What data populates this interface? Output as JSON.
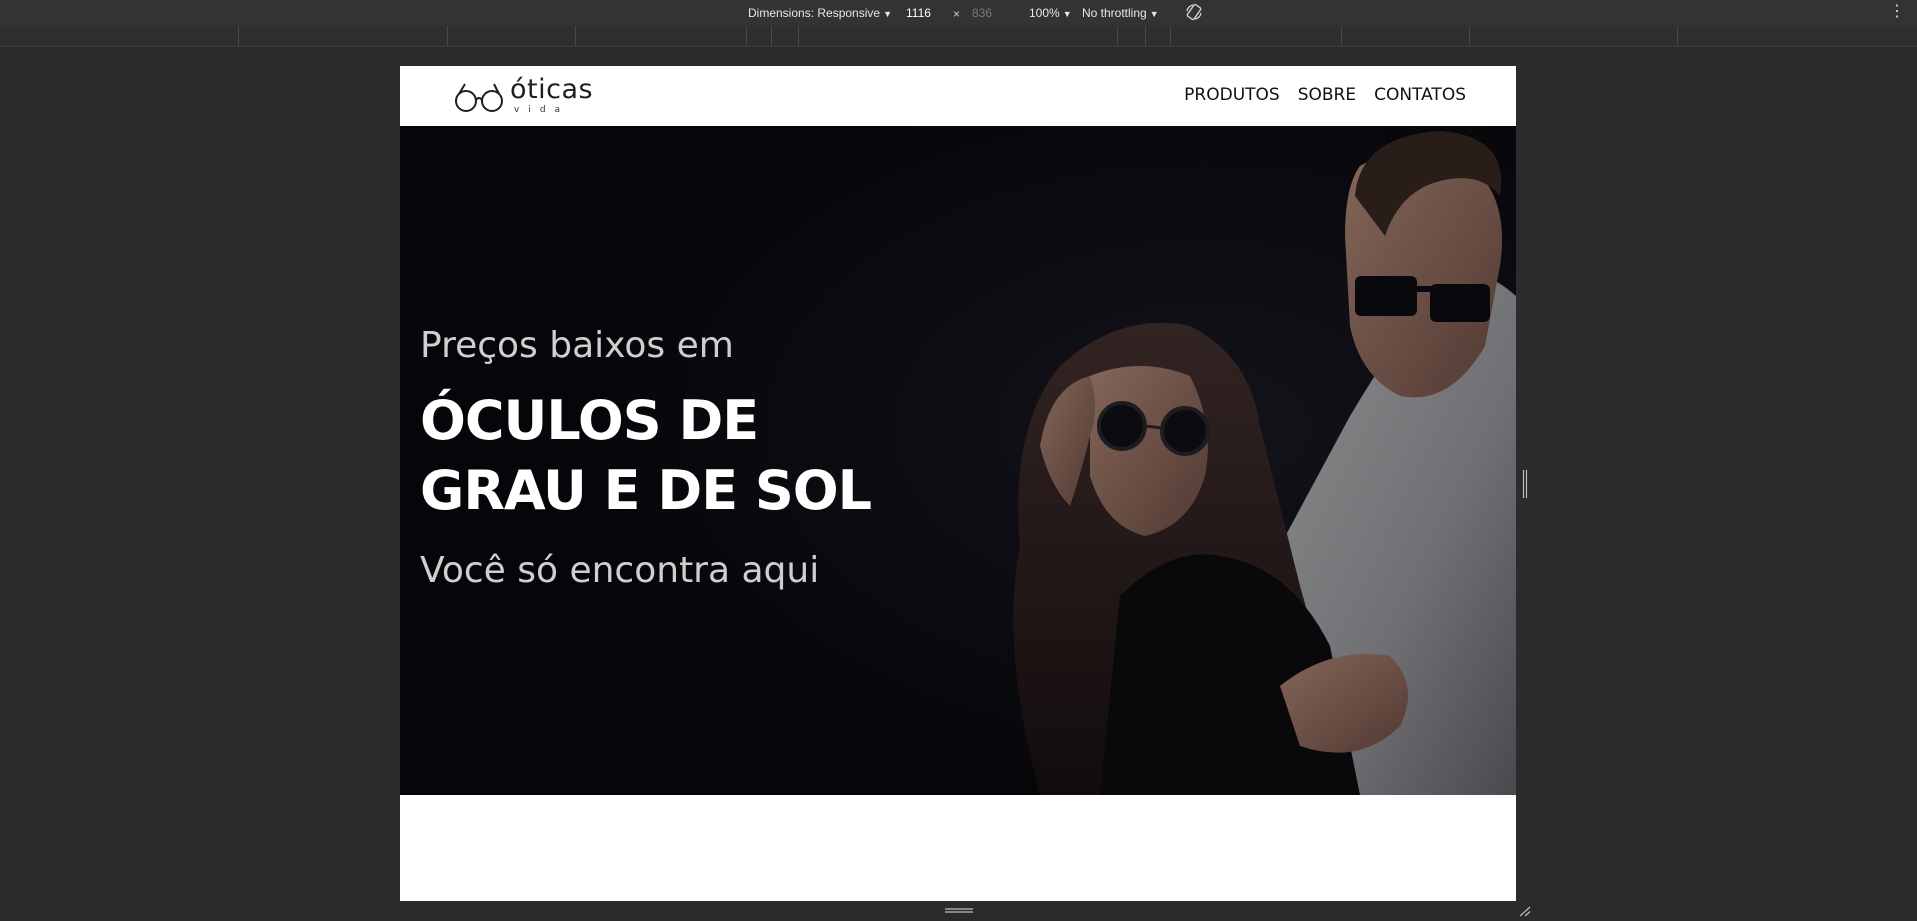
{
  "devtools": {
    "dimensions_label": "Dimensions: Responsive",
    "width_value": "1116",
    "times_sign": "×",
    "height_value": "836",
    "zoom": "100%",
    "throttling": "No throttling",
    "menu_glyph": "⋮",
    "icons": [
      "rotate-icon",
      "kebab-icon"
    ]
  },
  "site": {
    "logo_word": "óticas",
    "logo_sub": "vida",
    "nav": [
      "PRODUTOS",
      "SOBRE",
      "CONTATOS"
    ]
  },
  "hero": {
    "line1": "Preços baixos em",
    "title_line1": "ÓCULOS DE",
    "title_line2": "GRAU E DE SOL",
    "line3": "Você só encontra aqui"
  },
  "colors": {
    "devtools_bg": "#333333",
    "page_bg": "#2b2b2b",
    "hero_bg": "#07070c",
    "header_bg": "#ffffff",
    "hero_title": "#ffffff",
    "hero_subtext": "#cfcfcf"
  }
}
